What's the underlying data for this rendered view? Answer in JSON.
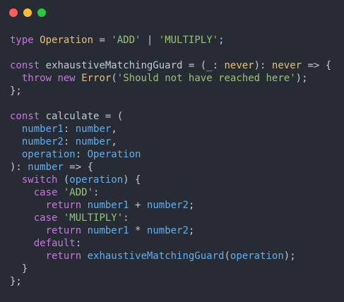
{
  "colors": {
    "background": "#272b33",
    "red": "#ff5f56",
    "yellow": "#ffbd2e",
    "green": "#27c93f",
    "keyword": "#c678dd",
    "type": "#e5c07b",
    "string": "#98c379",
    "function": "#61afef",
    "plain": "#c3cad6",
    "punct": "#c3cad6",
    "param": "#e06c75"
  },
  "window": {
    "controls": [
      {
        "name": "close-dot",
        "color": "#ff5f56"
      },
      {
        "name": "minimize-dot",
        "color": "#ffbd2e"
      },
      {
        "name": "zoom-dot",
        "color": "#27c93f"
      }
    ]
  },
  "code": {
    "lines": [
      [
        [
          "kw",
          "type"
        ],
        [
          "p",
          " "
        ],
        [
          "ty",
          "Operation"
        ],
        [
          "p",
          " = "
        ],
        [
          "str",
          "'ADD'"
        ],
        [
          "p",
          " | "
        ],
        [
          "str",
          "'MULTIPLY'"
        ],
        [
          "p",
          ";"
        ]
      ],
      [],
      [
        [
          "kw",
          "const"
        ],
        [
          "p",
          " exhaustiveMatchingGuard = ("
        ],
        [
          "p",
          "_"
        ],
        [
          "p",
          ": "
        ],
        [
          "ty",
          "never"
        ],
        [
          "p",
          "): "
        ],
        [
          "ty",
          "never"
        ],
        [
          "p",
          " => {"
        ]
      ],
      [
        [
          "p",
          "  "
        ],
        [
          "kw",
          "throw"
        ],
        [
          "p",
          " "
        ],
        [
          "kw",
          "new"
        ],
        [
          "p",
          " "
        ],
        [
          "ty",
          "Error"
        ],
        [
          "p",
          "("
        ],
        [
          "str",
          "'Should not have reached here'"
        ],
        [
          "p",
          ");"
        ]
      ],
      [
        [
          "p",
          "};"
        ]
      ],
      [],
      [
        [
          "kw",
          "const"
        ],
        [
          "p",
          " calculate = ("
        ]
      ],
      [
        [
          "p",
          "  "
        ],
        [
          "fn",
          "number1"
        ],
        [
          "p",
          ": "
        ],
        [
          "fn",
          "number"
        ],
        [
          "p",
          ","
        ]
      ],
      [
        [
          "p",
          "  "
        ],
        [
          "fn",
          "number2"
        ],
        [
          "p",
          ": "
        ],
        [
          "fn",
          "number"
        ],
        [
          "p",
          ","
        ]
      ],
      [
        [
          "p",
          "  "
        ],
        [
          "fn",
          "operation"
        ],
        [
          "p",
          ": "
        ],
        [
          "fn",
          "Operation"
        ]
      ],
      [
        [
          "p",
          "): "
        ],
        [
          "fn",
          "number"
        ],
        [
          "p",
          " => {"
        ]
      ],
      [
        [
          "p",
          "  "
        ],
        [
          "kw",
          "switch"
        ],
        [
          "p",
          " ("
        ],
        [
          "fn",
          "operation"
        ],
        [
          "p",
          ") {"
        ]
      ],
      [
        [
          "p",
          "    "
        ],
        [
          "kw",
          "case"
        ],
        [
          "p",
          " "
        ],
        [
          "str",
          "'ADD'"
        ],
        [
          "p",
          ":"
        ]
      ],
      [
        [
          "p",
          "      "
        ],
        [
          "kw",
          "return"
        ],
        [
          "p",
          " "
        ],
        [
          "fn",
          "number1"
        ],
        [
          "p",
          " + "
        ],
        [
          "fn",
          "number2"
        ],
        [
          "p",
          ";"
        ]
      ],
      [
        [
          "p",
          "    "
        ],
        [
          "kw",
          "case"
        ],
        [
          "p",
          " "
        ],
        [
          "str",
          "'MULTIPLY'"
        ],
        [
          "p",
          ":"
        ]
      ],
      [
        [
          "p",
          "      "
        ],
        [
          "kw",
          "return"
        ],
        [
          "p",
          " "
        ],
        [
          "fn",
          "number1"
        ],
        [
          "p",
          " * "
        ],
        [
          "fn",
          "number2"
        ],
        [
          "p",
          ";"
        ]
      ],
      [
        [
          "p",
          "    "
        ],
        [
          "kw",
          "default"
        ],
        [
          "p",
          ":"
        ]
      ],
      [
        [
          "p",
          "      "
        ],
        [
          "kw",
          "return"
        ],
        [
          "p",
          " "
        ],
        [
          "fn",
          "exhaustiveMatchingGuard"
        ],
        [
          "p",
          "("
        ],
        [
          "fn",
          "operation"
        ],
        [
          "p",
          ");"
        ]
      ],
      [
        [
          "p",
          "  }"
        ]
      ],
      [
        [
          "p",
          "};"
        ]
      ]
    ]
  }
}
